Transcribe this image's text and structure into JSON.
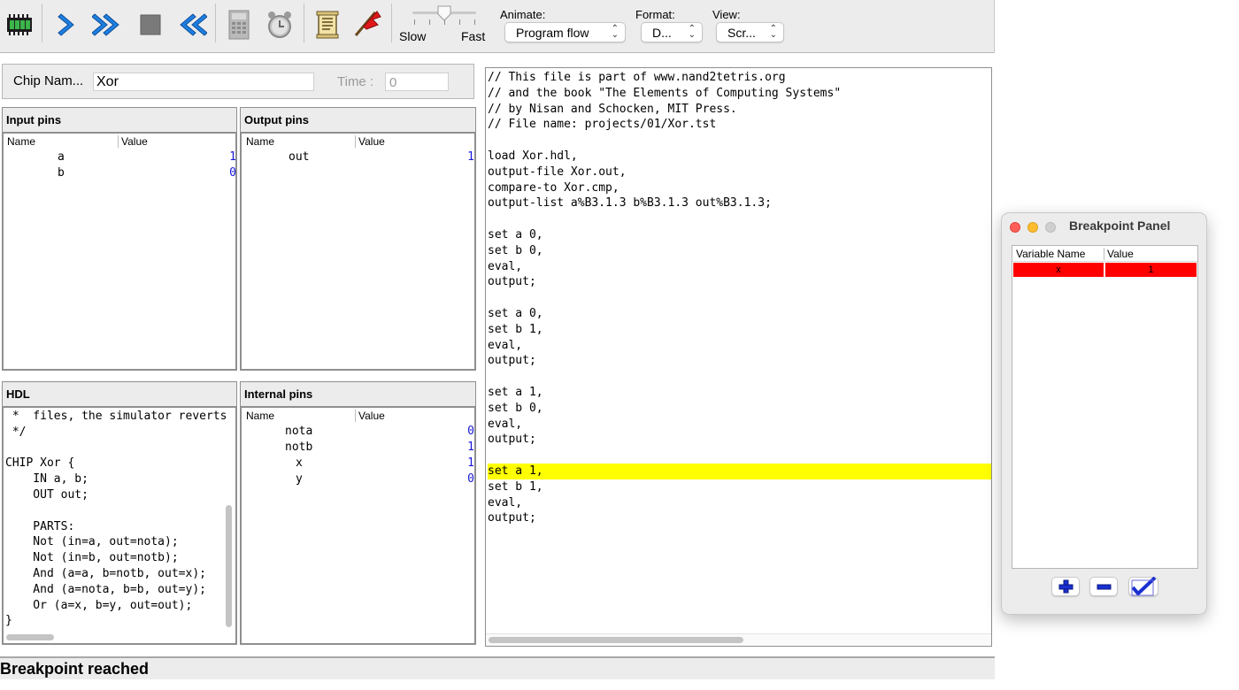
{
  "toolbar": {
    "icons": [
      "chip-icon",
      "single-step-icon",
      "fast-forward-icon",
      "stop-icon",
      "rewind-icon",
      "calculator-icon",
      "alarm-clock-icon",
      "script-icon",
      "breakpoint-flag-icon"
    ],
    "speed_slow": "Slow",
    "speed_fast": "Fast",
    "animate_label": "Animate:",
    "animate_value": "Program flow",
    "format_label": "Format:",
    "format_value": "D...",
    "view_label": "View:",
    "view_value": "Scr..."
  },
  "chip": {
    "name_label": "Chip Nam...",
    "name_value": "Xor",
    "time_label": "Time :",
    "time_value": "0"
  },
  "input_pins": {
    "title": "Input pins",
    "col_name": "Name",
    "col_value": "Value",
    "rows": [
      {
        "name": "a",
        "value": "1"
      },
      {
        "name": "b",
        "value": "0"
      }
    ]
  },
  "output_pins": {
    "title": "Output pins",
    "col_name": "Name",
    "col_value": "Value",
    "rows": [
      {
        "name": "out",
        "value": "1"
      }
    ]
  },
  "hdl": {
    "title": "HDL",
    "lines": [
      " *  files, the simulator reverts",
      " */",
      "",
      "CHIP Xor {",
      "    IN a, b;",
      "    OUT out;",
      "",
      "    PARTS:",
      "    Not (in=a, out=nota);",
      "    Not (in=b, out=notb);",
      "    And (a=a, b=notb, out=x);",
      "    And (a=nota, b=b, out=y);",
      "    Or (a=x, b=y, out=out);",
      "}"
    ]
  },
  "internal_pins": {
    "title": "Internal pins",
    "col_name": "Name",
    "col_value": "Value",
    "rows": [
      {
        "name": "nota",
        "value": "0"
      },
      {
        "name": "notb",
        "value": "1"
      },
      {
        "name": "x",
        "value": "1"
      },
      {
        "name": "y",
        "value": "0"
      }
    ]
  },
  "script": {
    "highlight_line": 25,
    "highlight_color": "#ffff00",
    "lines": [
      "// This file is part of www.nand2tetris.org",
      "// and the book \"The Elements of Computing Systems\"",
      "// by Nisan and Schocken, MIT Press.",
      "// File name: projects/01/Xor.tst",
      "",
      "load Xor.hdl,",
      "output-file Xor.out,",
      "compare-to Xor.cmp,",
      "output-list a%B3.1.3 b%B3.1.3 out%B3.1.3;",
      "",
      "set a 0,",
      "set b 0,",
      "eval,",
      "output;",
      "",
      "set a 0,",
      "set b 1,",
      "eval,",
      "output;",
      "",
      "set a 1,",
      "set b 0,",
      "eval,",
      "output;",
      "",
      "set a 1,",
      "set b 1,",
      "eval,",
      "output;"
    ]
  },
  "status": {
    "message": "Breakpoint reached"
  },
  "breakpoint_panel": {
    "title": "Breakpoint Panel",
    "col_name": "Variable Name",
    "col_value": "Value",
    "row_color": "#ff0000",
    "rows": [
      {
        "name": "x",
        "value": "1"
      }
    ],
    "add_icon": "plus-icon",
    "remove_icon": "minus-icon",
    "ok_icon": "checkmark-icon"
  },
  "colors": {
    "pin_value": "#1818d8",
    "toolbar_arrow": "#1e7fe0"
  }
}
